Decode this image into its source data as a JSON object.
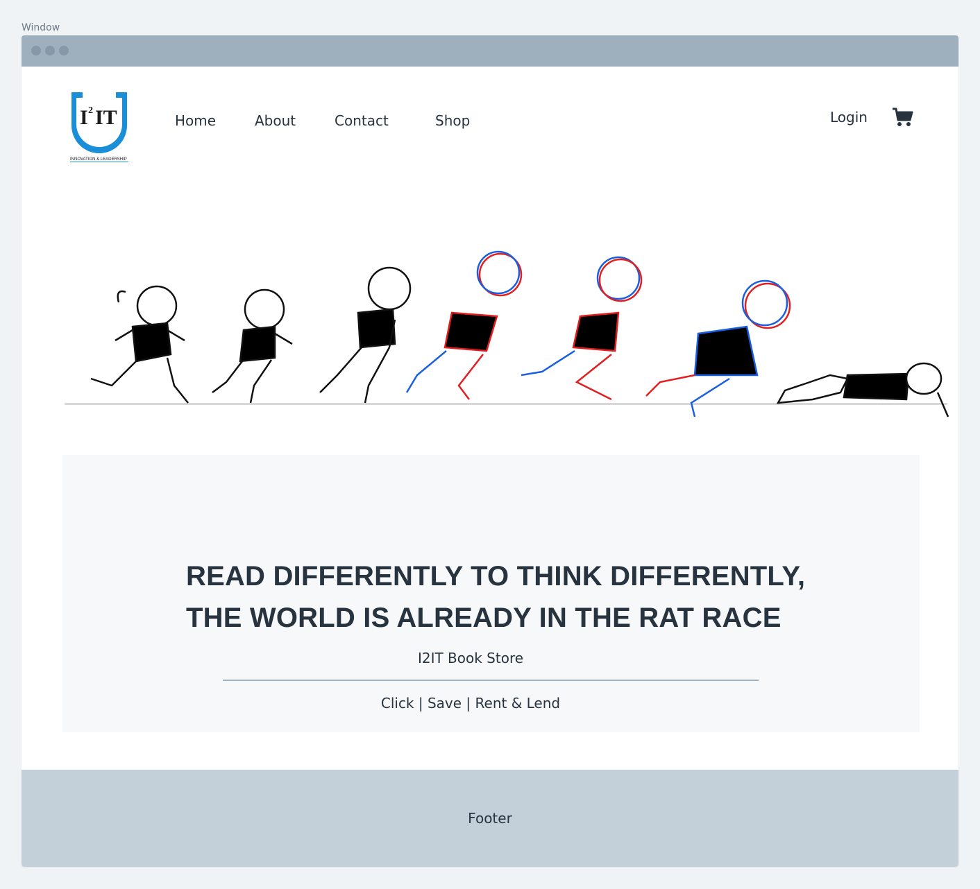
{
  "window": {
    "label": "Window"
  },
  "header": {
    "logo": {
      "text": "I2IT",
      "superscript": "2",
      "tagline": "INNOVATION & LEADERSHIP"
    },
    "nav": [
      {
        "label": "Home"
      },
      {
        "label": "About"
      },
      {
        "label": "Contact"
      },
      {
        "label": "Shop"
      }
    ],
    "login_label": "Login",
    "cart_icon": "cart-icon"
  },
  "hero": {
    "illustration": "running-girl-sequence-illustration"
  },
  "banner": {
    "headline_line1": "READ DIFFERENTLY TO THINK DIFFERENTLY,",
    "headline_line2": "THE WORLD IS ALREADY IN THE RAT RACE",
    "store_name": "I2IT Book Store",
    "tagline": "Click | Save | Rent & Lend"
  },
  "footer": {
    "text": "Footer"
  },
  "colors": {
    "brand_blue": "#1a8fd8",
    "titlebar": "#9eafbd",
    "footer_bg": "#c3cfd9",
    "text": "#27333f"
  }
}
